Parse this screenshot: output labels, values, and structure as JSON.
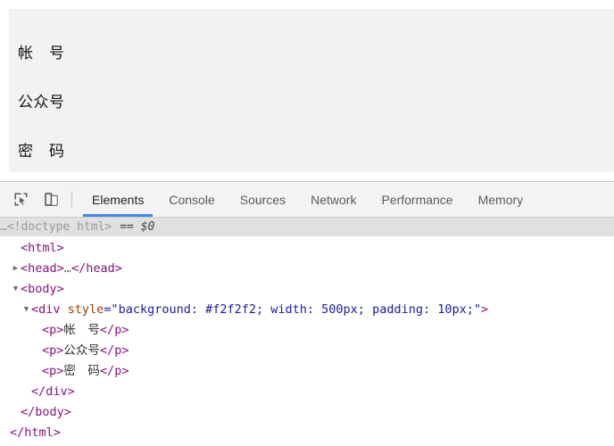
{
  "page": {
    "container_style": "background: #f2f2f2; width: 500px; padding: 10px;",
    "background_color": "#f2f2f2",
    "paragraphs": [
      {
        "text": "帐　号"
      },
      {
        "text": "公众号"
      },
      {
        "text": "密　码"
      }
    ]
  },
  "devtools": {
    "toolbar": {
      "inspect_icon": "inspect-element-icon",
      "device_icon": "device-toolbar-icon",
      "tabs": [
        {
          "label": "Elements",
          "active": true
        },
        {
          "label": "Console",
          "active": false
        },
        {
          "label": "Sources",
          "active": false
        },
        {
          "label": "Network",
          "active": false
        },
        {
          "label": "Performance",
          "active": false
        },
        {
          "label": "Memory",
          "active": false
        }
      ],
      "active_tab_underline_color": "#4285f4"
    },
    "doctype_bar": {
      "ellipsis": "…",
      "text": "<!doctype html>",
      "selection": "== $0",
      "background": "#e0e0e0"
    },
    "dom": {
      "line_html_open": {
        "open": "<",
        "name": "html",
        "close": ">"
      },
      "line_head": {
        "twisty": "▶",
        "open": "<",
        "name": "head",
        "close": ">",
        "ellipsis": "…",
        "end_open": "</",
        "end_name": "head",
        "end_close": ">"
      },
      "line_body_open": {
        "twisty": "▼",
        "open": "<",
        "name": "body",
        "close": ">"
      },
      "line_div_open": {
        "twisty": "▼",
        "open": "<",
        "name": "div",
        "attr_name": "style",
        "eq": "=",
        "quote": "\"",
        "attr_value": "background: #f2f2f2; width: 500px; padding: 10px;",
        "close": ">"
      },
      "p_lines": [
        {
          "open": "<",
          "name": "p",
          "close": ">",
          "text": "帐　号",
          "end_open": "</",
          "end_name": "p",
          "end_close": ">"
        },
        {
          "open": "<",
          "name": "p",
          "close": ">",
          "text": "公众号",
          "end_open": "</",
          "end_name": "p",
          "end_close": ">"
        },
        {
          "open": "<",
          "name": "p",
          "close": ">",
          "text": "密　码",
          "end_open": "</",
          "end_name": "p",
          "end_close": ">"
        }
      ],
      "line_div_close": {
        "open": "</",
        "name": "div",
        "close": ">"
      },
      "line_body_close": {
        "open": "</",
        "name": "body",
        "close": ">"
      },
      "line_html_close": {
        "open": "</",
        "name": "html",
        "close": ">"
      }
    },
    "colors": {
      "tag": "#881280",
      "attribute_name": "#994500",
      "attribute_value": "#1a1aa6",
      "toolbar_background": "#f3f3f3",
      "selected_row": "#e0e0e0"
    }
  }
}
